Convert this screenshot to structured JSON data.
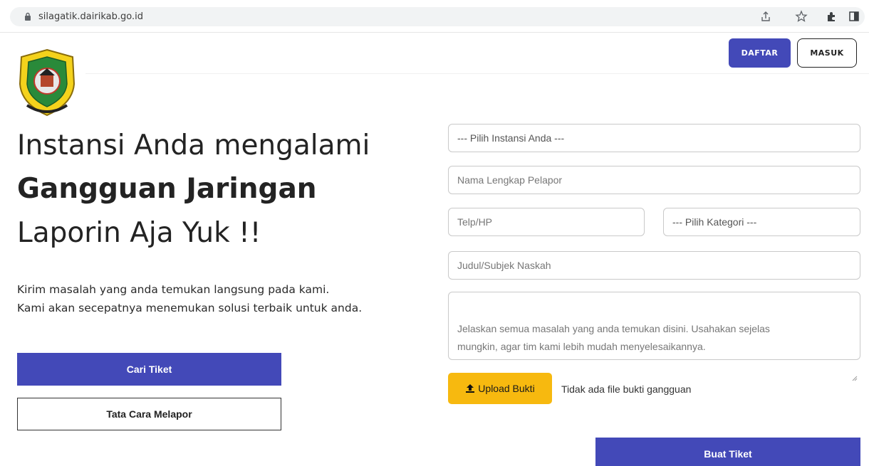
{
  "browser": {
    "url": "silagatik.dairikab.go.id",
    "icons": [
      "lock-icon",
      "share-icon",
      "star-icon",
      "extensions-icon",
      "side-panel-icon"
    ]
  },
  "header": {
    "daftar_label": "DAFTAR",
    "masuk_label": "MASUK",
    "logo_icon": "regency-crest-logo"
  },
  "hero": {
    "line1": "Instansi Anda mengalami",
    "line2": "Gangguan Jaringan",
    "line3": "Laporin Aja Yuk !!",
    "desc_line1": "Kirim masalah yang anda temukan langsung pada kami.",
    "desc_line2": "Kami akan secepatnya menemukan solusi terbaik untuk anda.",
    "cari_label": "Cari Tiket",
    "tatacara_label": "Tata Cara Melapor"
  },
  "form": {
    "instansi_selected": "--- Pilih Instansi Anda ---",
    "nama_placeholder": "Nama Lengkap Pelapor",
    "telp_placeholder": "Telp/HP",
    "kategori_selected": "--- Pilih Kategori ---",
    "judul_placeholder": "Judul/Subjek Naskah",
    "masalah_placeholder": "Jelaskan semua masalah yang anda temukan disini. Usahakan sejelas\nmungkin, agar tim kami lebih mudah menyelesaikannya.",
    "upload_label": "Upload Bukti",
    "upload_status": "Tidak ada file bukti gangguan",
    "buat_label": "Buat Tiket"
  },
  "colors": {
    "primary": "#4349b8",
    "upload": "#f7b90f",
    "text": "#232323"
  }
}
